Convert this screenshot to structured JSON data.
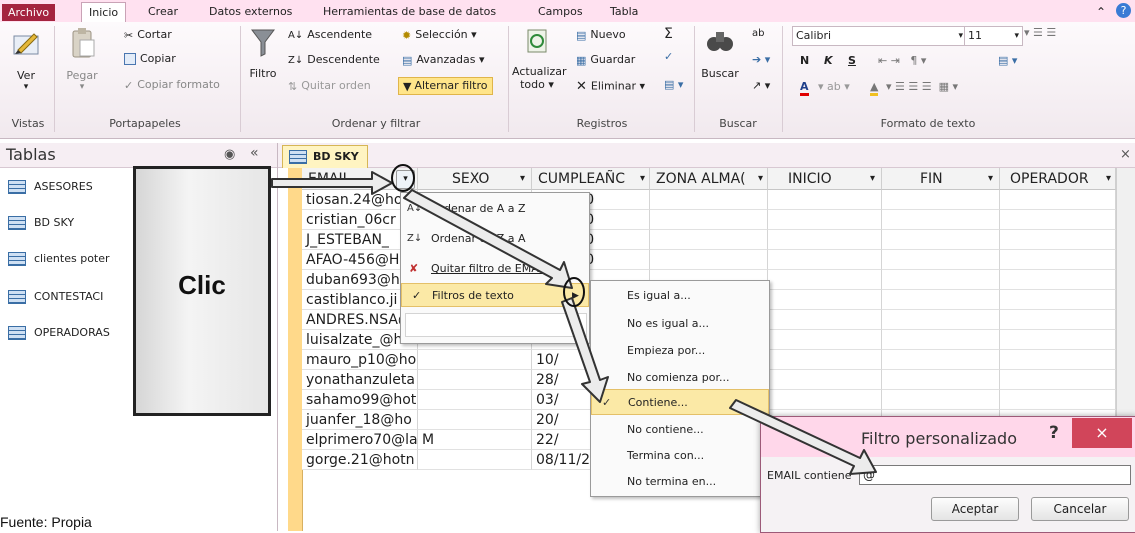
{
  "ribbon_tabs": [
    "Archivo",
    "Inicio",
    "Crear",
    "Datos externos",
    "Herramientas de base de datos",
    "Campos",
    "Tabla"
  ],
  "ribbon": {
    "vistas": {
      "ver": "Ver",
      "label": "Vistas"
    },
    "portapapeles": {
      "pegar": "Pegar",
      "cortar": "Cortar",
      "copiar": "Copiar",
      "copiar_formato": "Copiar formato",
      "label": "Portapapeles"
    },
    "ordenar": {
      "filtro": "Filtro",
      "ascendente": "Ascendente",
      "descendente": "Descendente",
      "quitar_orden": "Quitar orden",
      "seleccion": "Selección",
      "avanzadas": "Avanzadas",
      "alternar": "Alternar filtro",
      "label": "Ordenar y filtrar"
    },
    "registros": {
      "actualizar": "Actualizar",
      "todo": "todo",
      "nuevo": "Nuevo",
      "guardar": "Guardar",
      "eliminar": "Eliminar",
      "label": "Registros"
    },
    "buscar": {
      "buscar": "Buscar",
      "label": "Buscar"
    },
    "formato": {
      "font": "Calibri",
      "size": "11",
      "label": "Formato de texto"
    }
  },
  "nav": {
    "title": "Tablas",
    "items": [
      "ASESORES",
      "BD SKY",
      "clientes poter",
      "CONTESTACI",
      "OPERADORAS"
    ]
  },
  "doc_tab": "BD SKY",
  "columns": [
    "EMAIL",
    "SEXO",
    "CUMPLEAÑC",
    "ZONA ALMA(",
    "INICIO",
    "FIN",
    "OPERADOR"
  ],
  "rows": [
    {
      "email": "tiosan.24@ho",
      "sexo": "",
      "cumple": "07/2000"
    },
    {
      "email": "cristian_06cr",
      "sexo": "",
      "cumple": "09/2000"
    },
    {
      "email": "J_ESTEBAN_",
      "sexo": "",
      "cumple": "10/2000"
    },
    {
      "email": "AFAO-456@H",
      "sexo": "",
      "cumple": "11/2000"
    },
    {
      "email": "duban693@h",
      "sexo": "",
      "cumple": ""
    },
    {
      "email": "castiblanco.ji",
      "sexo": "",
      "cumple": ""
    },
    {
      "email": "ANDRES.NSA@",
      "sexo": "",
      "cumple": "11"
    },
    {
      "email": "luisalzate_@hot",
      "sexo": "M",
      "cumple": "23"
    },
    {
      "email": "mauro_p10@ho",
      "sexo": "",
      "cumple": "10/"
    },
    {
      "email": "yonathanzuleta",
      "sexo": "",
      "cumple": "28/"
    },
    {
      "email": "sahamo99@hot",
      "sexo": "",
      "cumple": "03/"
    },
    {
      "email": "juanfer_18@ho",
      "sexo": "",
      "cumple": "20/"
    },
    {
      "email": "elprimero70@la",
      "sexo": "M",
      "cumple": "22/"
    },
    {
      "email": "gorge.21@hotn",
      "sexo": "",
      "cumple": "08/11/2000"
    }
  ],
  "context_menu": [
    "Ordenar de A a Z",
    "Ordenar de Z a A",
    "Quitar filtro de EMAIL",
    "Filtros de texto"
  ],
  "submenu": [
    "Es igual a...",
    "No es igual a...",
    "Empieza por...",
    "No comienza por...",
    "Contiene...",
    "No contiene...",
    "Termina con...",
    "No termina en..."
  ],
  "dialog": {
    "title": "Filtro personalizado",
    "help": "?",
    "close": "×",
    "label": "EMAIL contiene",
    "value": "@",
    "ok": "Aceptar",
    "cancel": "Cancelar"
  },
  "annotation": {
    "clic": "Clic",
    "source": "Fuente: Propia"
  }
}
